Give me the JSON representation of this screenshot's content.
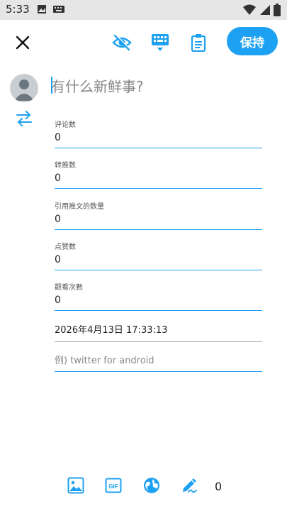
{
  "status_bar": {
    "time": "5:33"
  },
  "toolbar": {
    "save_label": "保持"
  },
  "compose": {
    "placeholder": "有什么新鲜事?"
  },
  "fields": [
    {
      "label": "评论数",
      "value": "0"
    },
    {
      "label": "转推数",
      "value": "0"
    },
    {
      "label": "引用推文的数量",
      "value": "0"
    },
    {
      "label": "点赞数",
      "value": "0"
    },
    {
      "label": "觀看次數",
      "value": "0"
    }
  ],
  "datetime": "2026年4月13日 17:33:13",
  "client": {
    "placeholder": "例) twitter for android"
  },
  "bottom_bar": {
    "count": "0"
  },
  "colors": {
    "accent": "#1da1f2",
    "status_bar": "#e6e6e6"
  }
}
